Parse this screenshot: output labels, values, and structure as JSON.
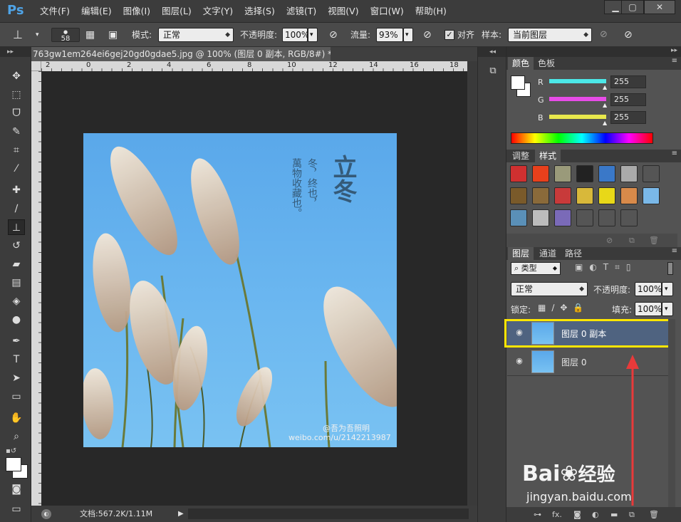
{
  "app": {
    "logo": "Ps"
  },
  "menu": [
    "文件(F)",
    "编辑(E)",
    "图像(I)",
    "图层(L)",
    "文字(Y)",
    "选择(S)",
    "滤镜(T)",
    "视图(V)",
    "窗口(W)",
    "帮助(H)"
  ],
  "window_buttons": [
    "▁",
    "▢",
    "✕"
  ],
  "options": {
    "brush_size": "58",
    "mode_label": "模式:",
    "mode_value": "正常",
    "opacity_label": "不透明度:",
    "opacity_value": "100%",
    "flow_label": "流量:",
    "flow_value": "93%",
    "align_label": "对齐",
    "sample_label": "样本:",
    "sample_value": "当前图层"
  },
  "document": {
    "tab_title": "763gw1em264ei6gej20gd0gdae5.jpg @ 100% (图层 0 副本, RGB/8#) *",
    "tab_close": "×",
    "ruler_labels": [
      "2",
      "0",
      "2",
      "4",
      "6",
      "8",
      "10",
      "12",
      "14",
      "16",
      "18"
    ],
    "status": "文档:567.2K/1.11M",
    "image_text": {
      "title": "立冬",
      "col1": "冬，终也，",
      "col2": "萬物收藏也。",
      "watermark_name": "@吾为吾照明",
      "watermark_url": "weibo.com/u/2142213987"
    }
  },
  "color_panel": {
    "tabs": [
      "颜色",
      "色板"
    ],
    "channels": [
      {
        "label": "R",
        "value": "255",
        "color": "#4ce8e8"
      },
      {
        "label": "G",
        "value": "255",
        "color": "#e84ce8"
      },
      {
        "label": "B",
        "value": "255",
        "color": "#e8e84c"
      }
    ]
  },
  "styles_panel": {
    "tabs": [
      "调整",
      "样式"
    ],
    "swatch_colors": [
      "#d03030",
      "#e8401c",
      "#9a9a7a",
      "#222222",
      "#3a78c8",
      "#aaaaaa",
      "#555555",
      "#7a5a2a",
      "#8a6a3a",
      "#c83a3a",
      "#d8b83a",
      "#e8d818",
      "#d88a4a",
      "#7ab8e8",
      "#5a90b8",
      "#bcbcbc",
      "#7a6ab8",
      "#555555",
      "#555555",
      "#555555"
    ]
  },
  "layers_panel": {
    "tabs": [
      "图层",
      "通道",
      "路径"
    ],
    "filter_label": "类型",
    "blend_mode": "正常",
    "opacity_label": "不透明度:",
    "opacity_value": "100%",
    "lock_label": "锁定:",
    "fill_label": "填充:",
    "fill_value": "100%",
    "layers": [
      {
        "name": "图层 0 副本",
        "selected": true
      },
      {
        "name": "图层 0",
        "selected": false
      }
    ],
    "bottom_icons": [
      "link-icon",
      "fx-icon",
      "mask-icon",
      "adjustment-icon",
      "group-icon",
      "new-layer-icon",
      "trash-icon"
    ]
  },
  "annotation": {
    "highlight_color": "#ffe600",
    "arrow_color": "#e83a3a"
  },
  "watermark": {
    "brand": "Bai",
    "brand2": "经验",
    "url": "jingyan.baidu.com"
  }
}
